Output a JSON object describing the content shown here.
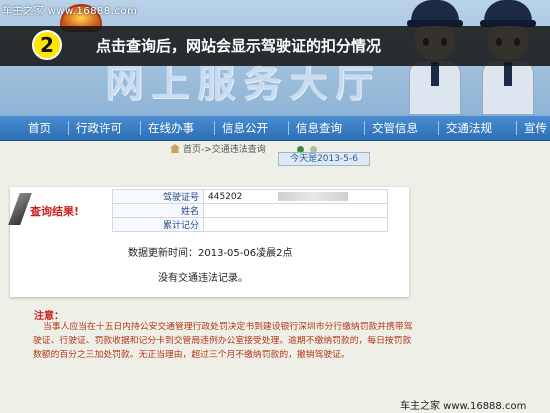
{
  "watermark_top": "车主之家 www.16888.com",
  "banner_bg_title": "网上服务大厅",
  "step": {
    "number": "2",
    "text": "点击查询后，网站会显示驾驶证的扣分情况"
  },
  "nav": {
    "items": [
      "首页",
      "行政许可",
      "在线办事",
      "信息公开",
      "信息查询",
      "交管信息",
      "交通法规",
      "宣传"
    ]
  },
  "breadcrumb": "首页->交通违法查询",
  "today": "今天是2013-5-6",
  "result": {
    "label": "查询结果!",
    "rows": [
      {
        "key": "驾驶证号",
        "value": "445202"
      },
      {
        "key": "姓名",
        "value": ""
      },
      {
        "key": "累计记分",
        "value": ""
      }
    ],
    "update_time": "数据更新时间：2013-05-06凌晨2点",
    "no_record": "没有交通违法记录。"
  },
  "notice": {
    "title": "注意：",
    "body": "当事人应当在十五日内持公安交通管理行政处罚决定书到建设银行深圳市分行缴纳罚款并携带驾驶证、行驶证、罚款收据和记分卡到交管局违例办公室接受处理。逾期不缴纳罚款的，每日按罚款数额的百分之三加处罚款。无正当理由，超过三个月不缴纳罚款的，撤销驾驶证。"
  },
  "watermark_bottom": "车主之家 www.16888.com"
}
